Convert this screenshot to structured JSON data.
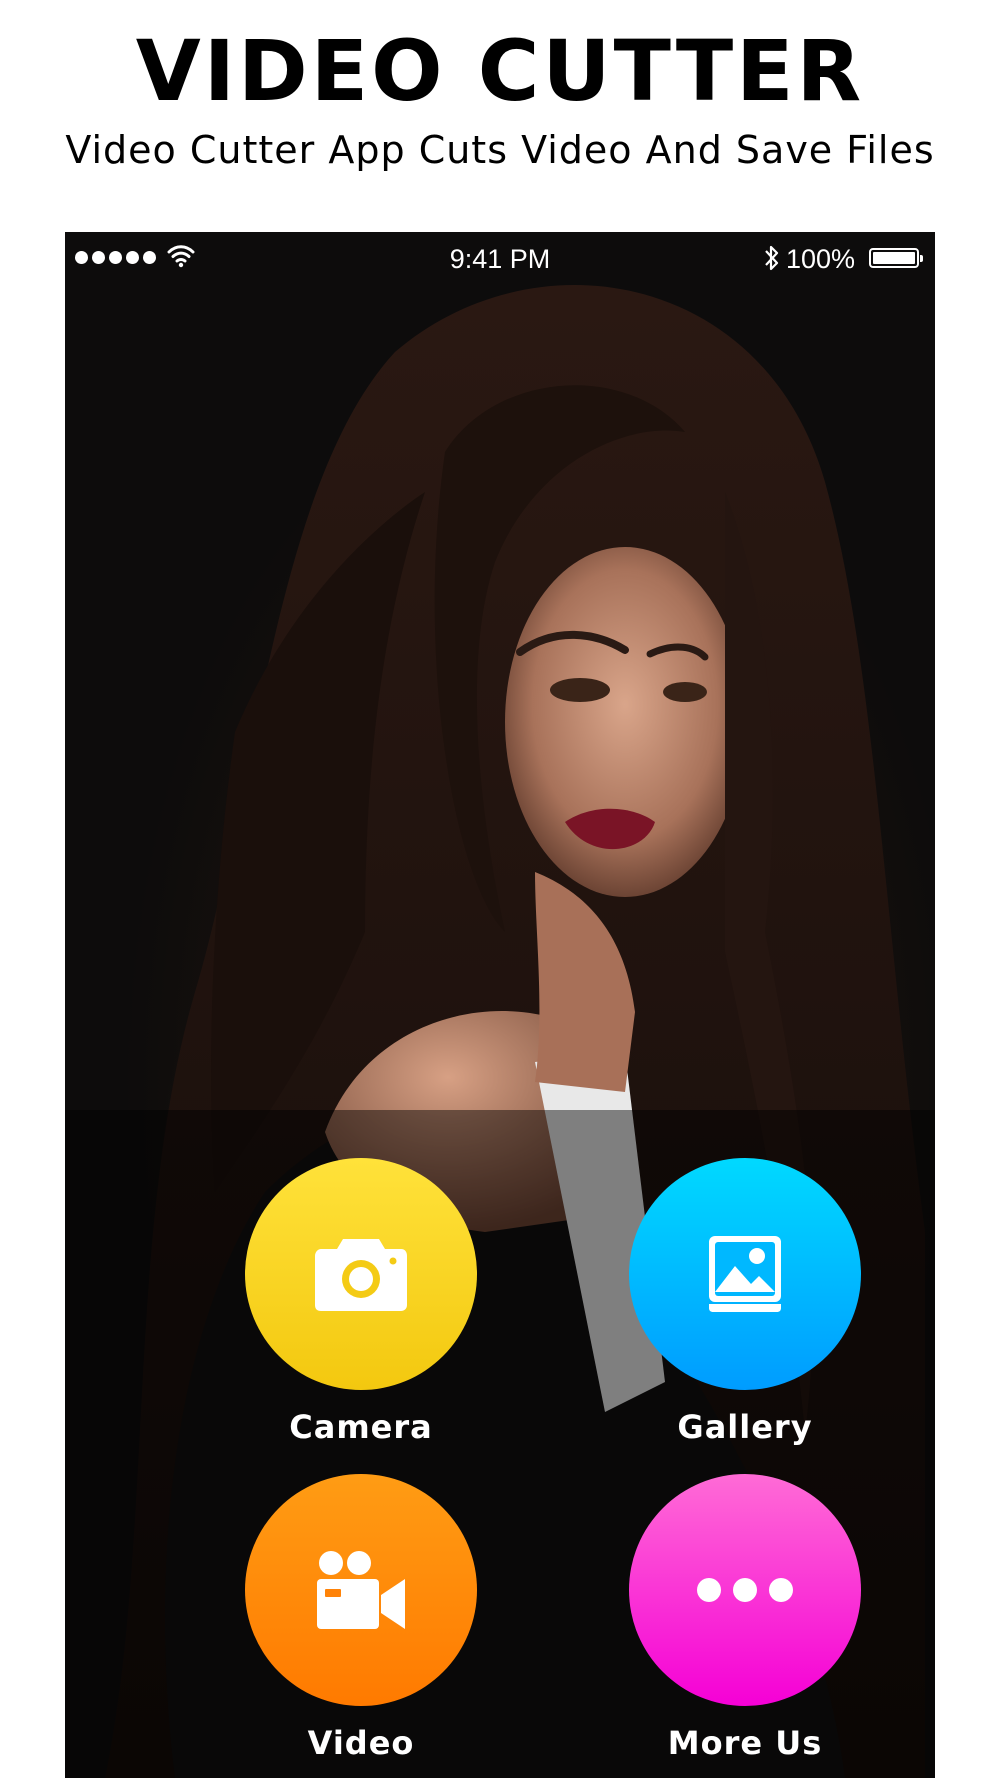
{
  "promo": {
    "title": "VIDEO CUTTER",
    "subtitle": "Video Cutter App Cuts Video And Save Files"
  },
  "status_bar": {
    "time": "9:41 PM",
    "battery": "100%",
    "icons": [
      "signal-dots-icon",
      "wifi-icon",
      "bluetooth-icon",
      "battery-icon"
    ]
  },
  "menu": {
    "items": [
      {
        "label": "Camera",
        "icon": "camera-icon",
        "color": "#f7d21c"
      },
      {
        "label": "Gallery",
        "icon": "gallery-icon",
        "color": "#00b8ff"
      },
      {
        "label": "Video",
        "icon": "video-camera-icon",
        "color": "#ff8a08"
      },
      {
        "label": "More Us",
        "icon": "more-dots-icon",
        "color": "#fb35d8"
      }
    ]
  }
}
